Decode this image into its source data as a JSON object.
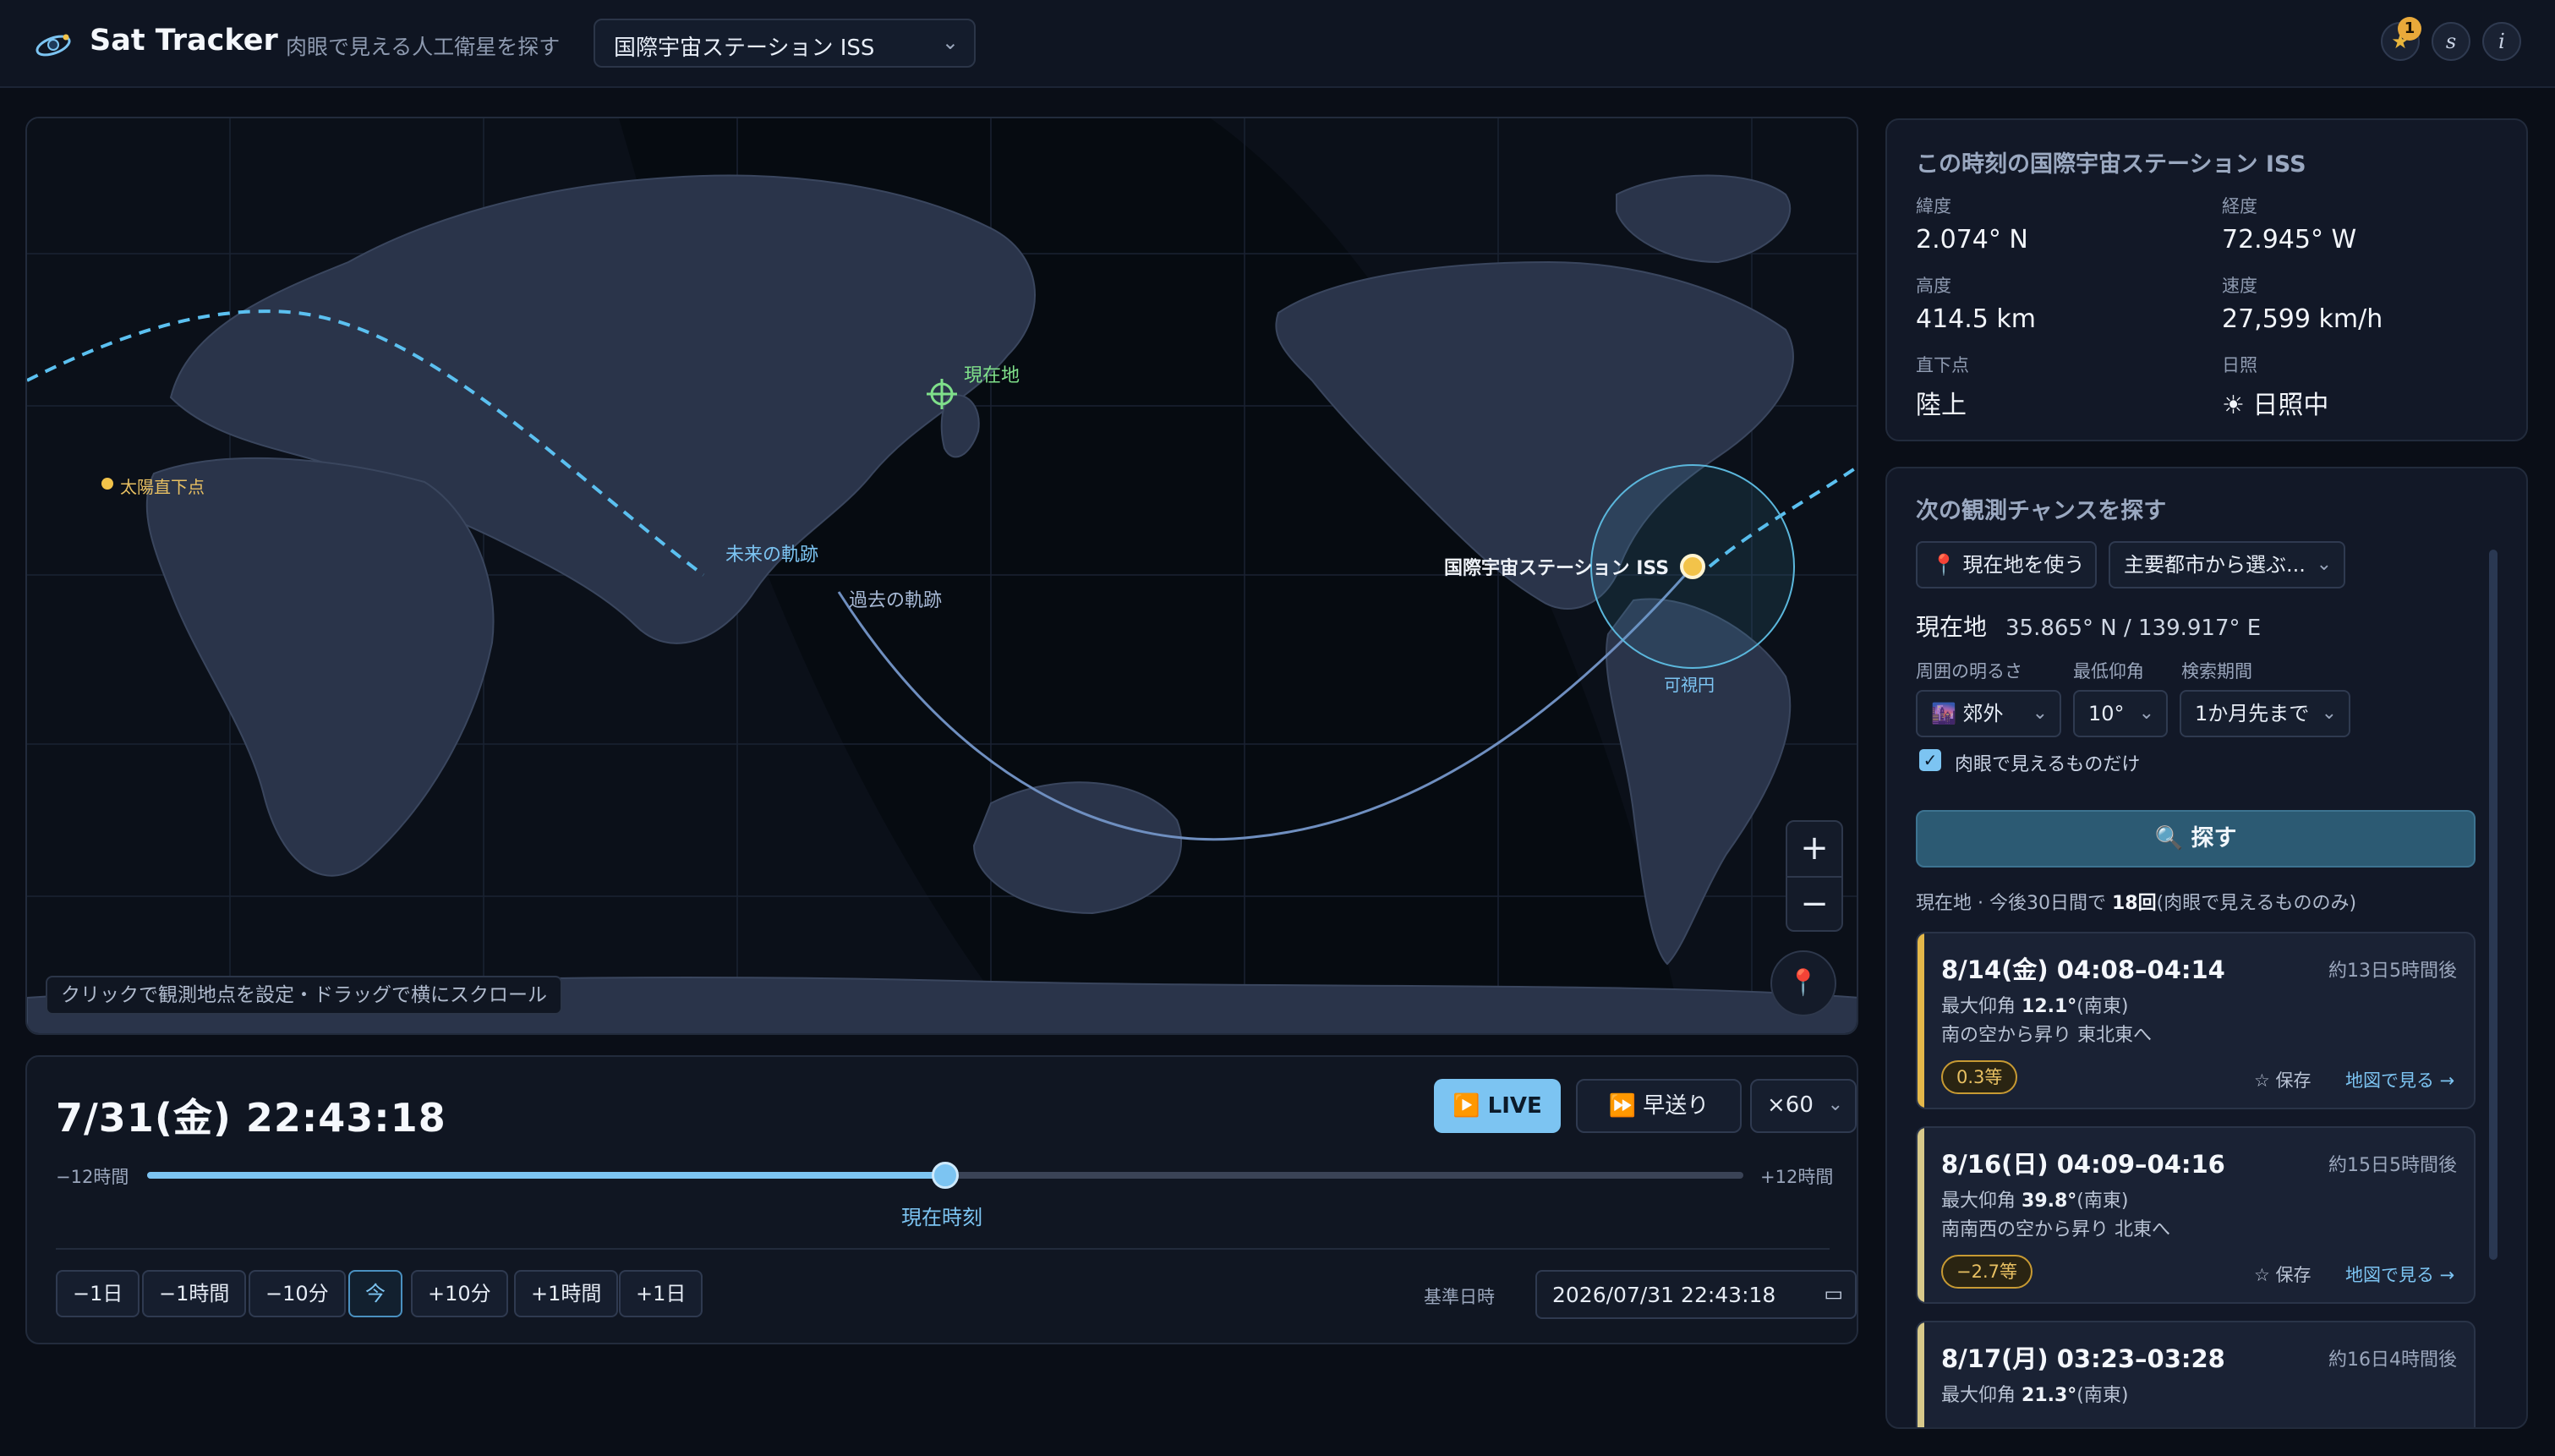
{
  "header": {
    "title": "Sat Tracker",
    "subtitle": "肉眼で見える人工衛星を探す",
    "satellite": "国際宇宙ステーション ISS",
    "favorites_count": "1",
    "button_s": "s",
    "button_i": "i"
  },
  "map": {
    "current_location_label": "現在地",
    "sun_label": "太陽直下点",
    "future_track_label": "未来の軌跡",
    "past_track_label": "過去の軌跡",
    "satellite_label": "国際宇宙ステーション ISS",
    "visibility_label": "可視円",
    "hint": "クリックで観測地点を設定・ドラッグで横にスクロール",
    "zoom_in": "+",
    "zoom_out": "−"
  },
  "time": {
    "display": "7/31(金) 22:43:18",
    "live": "▶️ LIVE",
    "fast_forward": "⏩ 早送り",
    "speed": "×60",
    "range_min": "−12時間",
    "range_max": "+12時間",
    "slider_value": 0.5,
    "now_label": "現在時刻",
    "steps": [
      "−1日",
      "−1時間",
      "−10分",
      "今",
      "+10分",
      "+1時間",
      "+1日"
    ],
    "base_label": "基準日時",
    "base_value": "2026/07/31 22:43:18"
  },
  "info": {
    "title": "この時刻の国際宇宙ステーション ISS",
    "lat_label": "緯度",
    "lat": "2.074° N",
    "lon_label": "経度",
    "lon": "72.945° W",
    "alt_label": "高度",
    "alt": "414.5 km",
    "speed_label": "速度",
    "speed": "27,599 km/h",
    "sub_label": "直下点",
    "sub": "陸上",
    "sun_label": "日照",
    "sun": "☀ 日照中"
  },
  "search": {
    "title": "次の観測チャンスを探す",
    "use_location": "📍 現在地を使う",
    "city_select": "主要都市から選ぶ...",
    "location_label": "現在地",
    "location_coords": "35.865° N / 139.917° E",
    "brightness_label": "周囲の明るさ",
    "brightness": "🌆 郊外",
    "elevation_label": "最低仰角",
    "elevation": "10°",
    "period_label": "検索期間",
    "period": "1か月先まで",
    "naked_eye_only": "肉眼で見えるものだけ",
    "search_button": "🔍 探す",
    "summary_prefix": "現在地 · 今後30日間で",
    "summary_count": "18回",
    "summary_suffix": "(肉眼で見えるもののみ)"
  },
  "passes": [
    {
      "title": "8/14(金) 04:08–04:14",
      "relative": "約13日5時間後",
      "max_elev_label": "最大仰角",
      "max_elev": "12.1°",
      "max_elev_dir": "(南東)",
      "path": "南の空から昇り 東北東へ",
      "mag": "0.3等",
      "save": "☆ 保存",
      "map": "地図で見る →"
    },
    {
      "title": "8/16(日) 04:09–04:16",
      "relative": "約15日5時間後",
      "max_elev_label": "最大仰角",
      "max_elev": "39.8°",
      "max_elev_dir": "(南東)",
      "path": "南南西の空から昇り 北東へ",
      "mag": "−2.7等",
      "save": "☆ 保存",
      "map": "地図で見る →"
    },
    {
      "title": "8/17(月) 03:23–03:28",
      "relative": "約16日4時間後",
      "max_elev_label": "最大仰角",
      "max_elev": "21.3°",
      "max_elev_dir": "(南東)"
    }
  ],
  "colors": {
    "accent": "#7cc4f2",
    "land": "#2a344a",
    "ocean": "#0b1019",
    "night": "#06090f",
    "track_future": "#5bc0f0",
    "track_past": "#6f8fc0",
    "sun": "#f2c34a",
    "location": "#7fe08a",
    "magnitude": "#e4b84a"
  }
}
